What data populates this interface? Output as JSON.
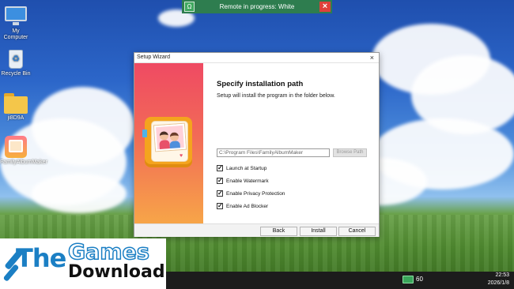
{
  "remote_banner": {
    "text": "Remote in progress: White"
  },
  "desktop_icons": [
    {
      "label": "My Computer"
    },
    {
      "label": "Recycle Bin"
    },
    {
      "label": "ji8D9A"
    },
    {
      "label": "FamilyAlbumMaker"
    }
  ],
  "wizard": {
    "title": "Setup Wizard",
    "close": "×",
    "heading": "Specify installation path",
    "subheading": "Setup will install the program in the folder below.",
    "path_value": "C:\\Program Files\\FamilyAlbumMaker",
    "browse_label": "Browse Path",
    "options": [
      {
        "label": "Launch at Startup",
        "checked": true
      },
      {
        "label": "Enable Watermark",
        "checked": true
      },
      {
        "label": "Enable Privacy Protection",
        "checked": true
      },
      {
        "label": "Enable Ad Blocker",
        "checked": true
      }
    ],
    "buttons": {
      "back": "Back",
      "install": "Install",
      "cancel": "Cancel"
    }
  },
  "logo": {
    "the": "The",
    "games": "Games",
    "download": "Download"
  },
  "taskbar": {
    "money": "60",
    "time": "22:53",
    "date": "2026/1/8"
  },
  "colors": {
    "banner": "#2e7d4f",
    "wizard_side_top": "#ef4a63",
    "wizard_side_bottom": "#f7a548",
    "logo_blue": "#1b7fc4"
  }
}
